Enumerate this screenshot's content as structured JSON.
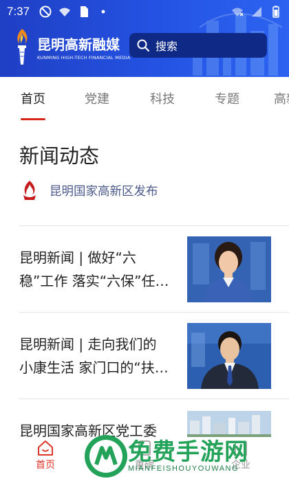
{
  "status_bar": {
    "time": "7:37"
  },
  "header": {
    "brand_cn": "昆明高新融媒",
    "brand_en": "KUNMING HIGH-TECH FINANCIAL MEDIA",
    "search_placeholder": "搜索"
  },
  "tabs": [
    {
      "label": "首页",
      "active": true
    },
    {
      "label": "党建",
      "active": false
    },
    {
      "label": "科技",
      "active": false
    },
    {
      "label": "专题",
      "active": false
    },
    {
      "label": "高新",
      "active": false
    }
  ],
  "section": {
    "title": "新闻动态",
    "publisher": "昆明国家高新区发布"
  },
  "news": [
    {
      "line1": "昆明新闻 | 做好“六",
      "line2": "稳”工作 落实“六保”任…",
      "thumb": "female-anchor"
    },
    {
      "line1": "昆明新闻 | 走向我们的",
      "line2": "小康生活 家门口的“扶…",
      "thumb": "male-anchor"
    },
    {
      "line1": "昆明国家高新区党工委",
      "line2": "",
      "thumb": "city-aerial"
    }
  ],
  "bottom_nav": [
    {
      "label": "首页",
      "icon": "home-icon",
      "active": true
    },
    {
      "label": "重磅",
      "icon": "book-icon",
      "active": false
    },
    {
      "label": "企业",
      "icon": "building-icon",
      "active": false
    }
  ],
  "watermark": {
    "cn": "免费手游网",
    "en": "MIANFEISHOUYOUWANG"
  },
  "colors": {
    "header_blue": "#2453e3",
    "search_bg": "#0e2a86",
    "accent_red": "#d8251a",
    "watermark_green": "#23a35a"
  }
}
